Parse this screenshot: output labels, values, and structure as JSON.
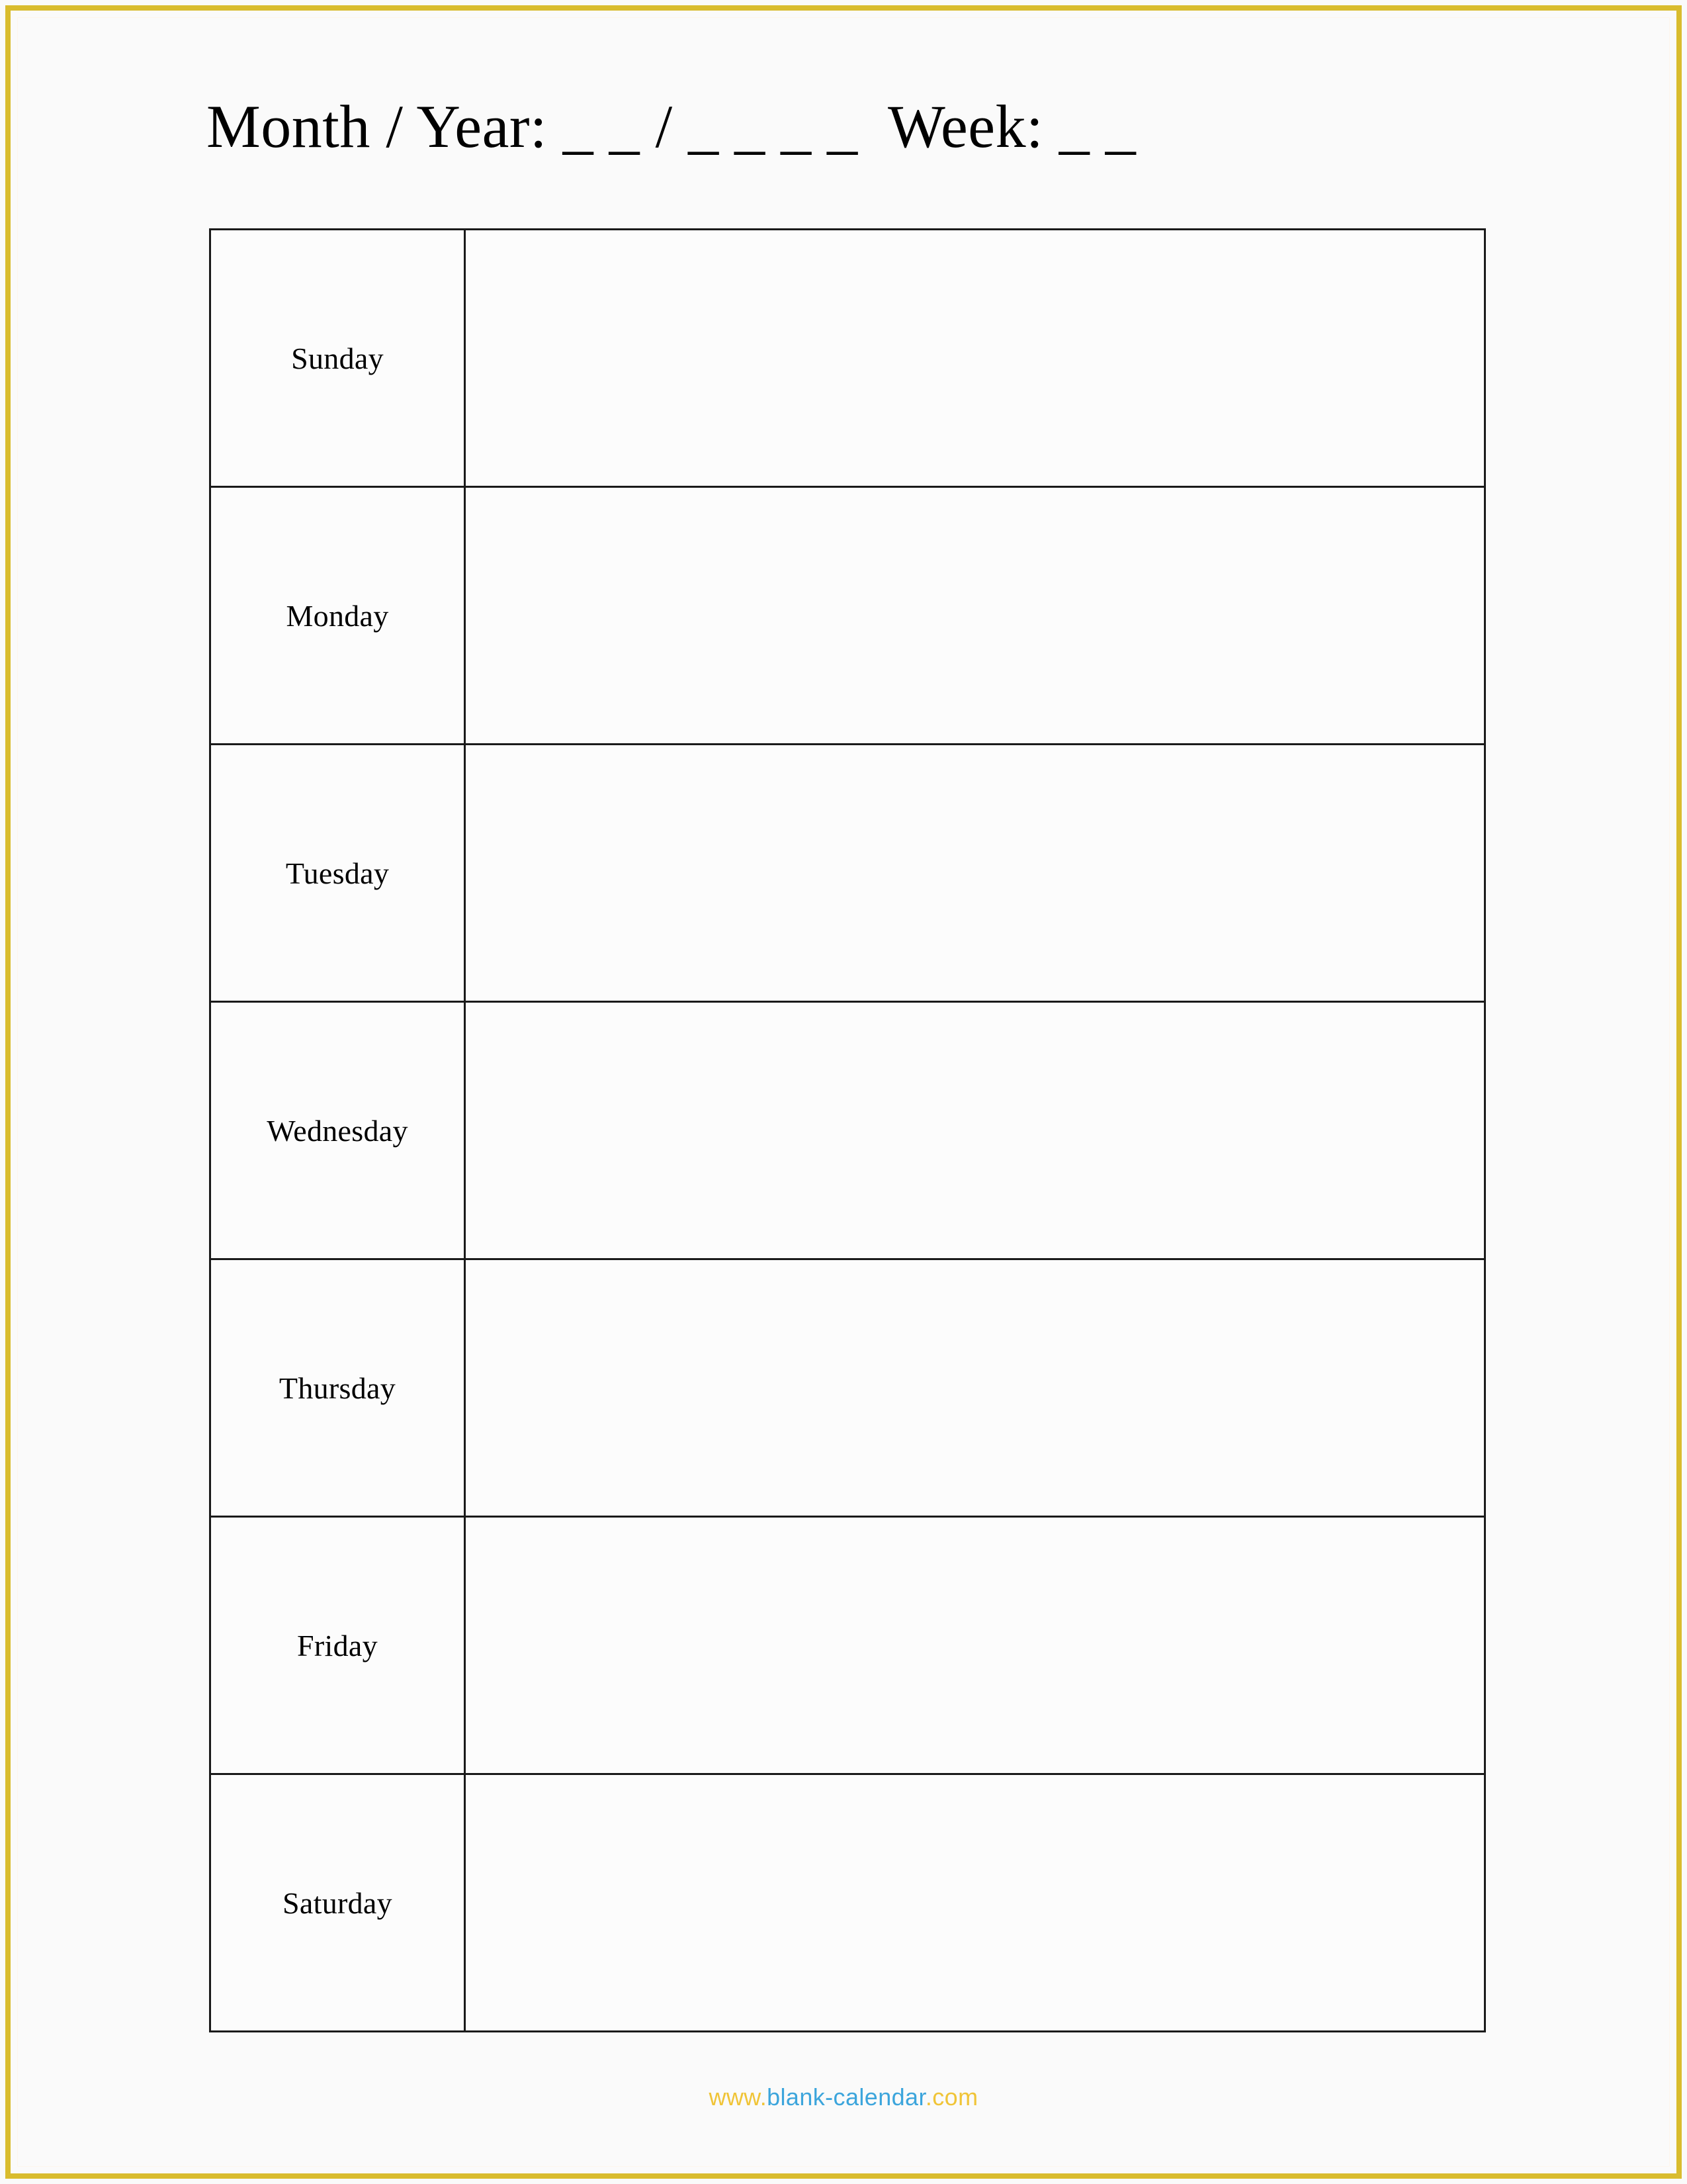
{
  "page": {
    "background_color": "#fafafa",
    "border_color": "#d9bc2e"
  },
  "header": {
    "title": "Month / Year: _ _ / _ _ _ _  Week: _ _",
    "month_label": "Month / Year:",
    "month_blank": "_ _",
    "separator": "/",
    "year_blank": "_ _ _ _",
    "week_label": "Week:",
    "week_blank": "_ _"
  },
  "calendar": {
    "rows": [
      {
        "day": "Sunday",
        "notes": ""
      },
      {
        "day": "Monday",
        "notes": ""
      },
      {
        "day": "Tuesday",
        "notes": ""
      },
      {
        "day": "Wednesday",
        "notes": ""
      },
      {
        "day": "Thursday",
        "notes": ""
      },
      {
        "day": "Friday",
        "notes": ""
      },
      {
        "day": "Saturday",
        "notes": ""
      }
    ]
  },
  "footer": {
    "prefix": "www.",
    "domain": "blank-calendar",
    "suffix": ".com",
    "full": "www.blank-calendar.com",
    "prefix_color": "#f0c437",
    "domain_color": "#3ca5dc",
    "suffix_color": "#f0c437"
  }
}
